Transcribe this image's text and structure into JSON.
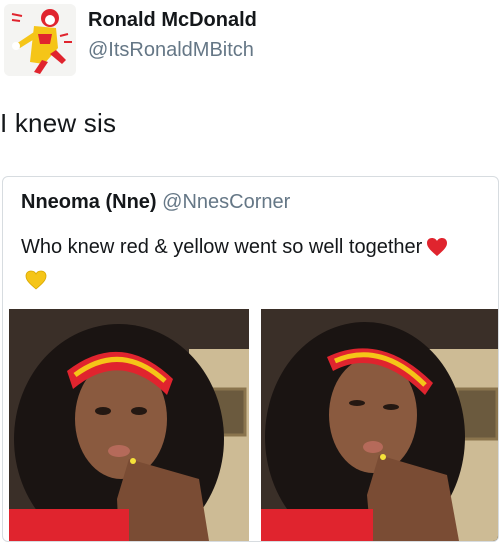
{
  "tweet": {
    "author_name": "Ronald McDonald",
    "author_handle": "@ItsRonaldMBitch",
    "text": "I knew sis"
  },
  "quoted_tweet": {
    "author_name": "Nneoma (Nne)",
    "author_handle": "@NnesCorner",
    "text": "Who knew red & yellow went so well together",
    "emojis": [
      "red-heart",
      "yellow-heart"
    ]
  },
  "colors": {
    "name": "#14171a",
    "handle": "#657786",
    "border": "#d7dce0",
    "red_heart": "#e0242e",
    "yellow_heart": "#f5c518"
  }
}
